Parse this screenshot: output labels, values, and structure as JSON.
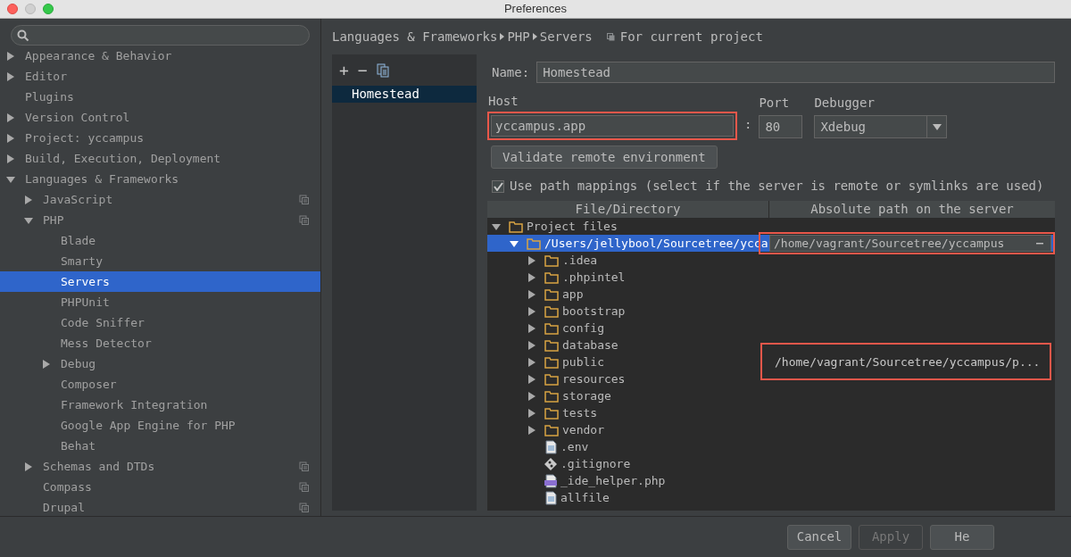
{
  "window": {
    "title": "Preferences"
  },
  "sidebar": {
    "items": [
      {
        "label": "Appearance & Behavior",
        "expanded": false,
        "selected": false
      },
      {
        "label": "Editor",
        "expanded": false,
        "selected": false
      },
      {
        "label": "Plugins",
        "selected": false
      },
      {
        "label": "Version Control",
        "expanded": false,
        "selected": false
      },
      {
        "label": "Project: yccampus",
        "expanded": false,
        "selected": false
      },
      {
        "label": "Build, Execution, Deployment",
        "expanded": false,
        "selected": false
      },
      {
        "label": "Languages & Frameworks",
        "expanded": true,
        "selected": false,
        "children": [
          {
            "label": "JavaScript",
            "expanded": false,
            "selected": false,
            "project_level": true
          },
          {
            "label": "PHP",
            "expanded": true,
            "selected": false,
            "project_level": true,
            "children": [
              {
                "label": "Blade",
                "selected": false
              },
              {
                "label": "Smarty",
                "selected": false
              },
              {
                "label": "Servers",
                "selected": true
              },
              {
                "label": "PHPUnit",
                "selected": false
              },
              {
                "label": "Code Sniffer",
                "selected": false
              },
              {
                "label": "Mess Detector",
                "selected": false
              },
              {
                "label": "Debug",
                "expanded": false,
                "selected": false
              },
              {
                "label": "Composer",
                "selected": false
              },
              {
                "label": "Framework Integration",
                "selected": false
              },
              {
                "label": "Google App Engine for PHP",
                "selected": false
              },
              {
                "label": "Behat",
                "selected": false
              }
            ]
          },
          {
            "label": "Schemas and DTDs",
            "expanded": false,
            "selected": false,
            "project_level": true
          },
          {
            "label": "Compass",
            "selected": false,
            "project_level": true
          },
          {
            "label": "Drupal",
            "selected": false,
            "project_level": true
          }
        ]
      }
    ]
  },
  "breadcrumb": {
    "parts": [
      "Languages & Frameworks",
      "PHP",
      "Servers"
    ],
    "scope": "For current project"
  },
  "server_list": {
    "toolbar": [
      "+",
      "−"
    ],
    "items": [
      {
        "label": "Homestead",
        "selected": true
      }
    ]
  },
  "form": {
    "name_label": "Name:",
    "name": "Homestead",
    "host_label": "Host",
    "host": "yccampus.app",
    "separator": ":",
    "port_label": "Port",
    "port": "80",
    "debugger_label": "Debugger",
    "debugger": "Xdebug",
    "validate_button": "Validate remote environment",
    "path_mappings": {
      "label": "Use path mappings (select if the server is remote or symlinks are used)",
      "checked": true
    }
  },
  "mappings": {
    "columns": [
      "File/Directory",
      "Absolute path on the server"
    ],
    "rows": [
      {
        "label": "Project files",
        "kind": "folder",
        "expanded": true,
        "selected": false,
        "children": [
          {
            "label": "/Users/jellybool/Sourcetree/ycca",
            "kind": "folder",
            "expanded": true,
            "selected": true,
            "server_path": "/home/vagrant/Sourcetree/yccampus",
            "editing": true,
            "children": [
              {
                "label": ".idea",
                "kind": "folder",
                "expanded": false,
                "selected": false
              },
              {
                "label": ".phpintel",
                "kind": "folder",
                "expanded": false,
                "selected": false
              },
              {
                "label": "app",
                "kind": "folder",
                "expanded": false,
                "selected": false
              },
              {
                "label": "bootstrap",
                "kind": "folder",
                "expanded": false,
                "selected": false
              },
              {
                "label": "config",
                "kind": "folder",
                "expanded": false,
                "selected": false
              },
              {
                "label": "database",
                "kind": "folder",
                "expanded": false,
                "selected": false
              },
              {
                "label": "public",
                "kind": "folder",
                "expanded": false,
                "selected": false,
                "server_path": "/home/vagrant/Sourcetree/yccampus/p...",
                "editing": false
              },
              {
                "label": "resources",
                "kind": "folder",
                "expanded": false,
                "selected": false
              },
              {
                "label": "storage",
                "kind": "folder",
                "expanded": false,
                "selected": false
              },
              {
                "label": "tests",
                "kind": "folder",
                "expanded": false,
                "selected": false
              },
              {
                "label": "vendor",
                "kind": "folder",
                "expanded": false,
                "selected": false
              },
              {
                "label": ".env",
                "kind": "file",
                "selected": false
              },
              {
                "label": ".gitignore",
                "kind": "git",
                "selected": false
              },
              {
                "label": "_ide_helper.php",
                "kind": "php",
                "selected": false
              },
              {
                "label": "allfile",
                "kind": "file",
                "selected": false
              }
            ]
          }
        ]
      }
    ]
  },
  "buttons": [
    {
      "label": "Cancel",
      "disabled": false
    },
    {
      "label": "Apply",
      "disabled": true
    },
    {
      "label": "He",
      "disabled": false
    }
  ]
}
